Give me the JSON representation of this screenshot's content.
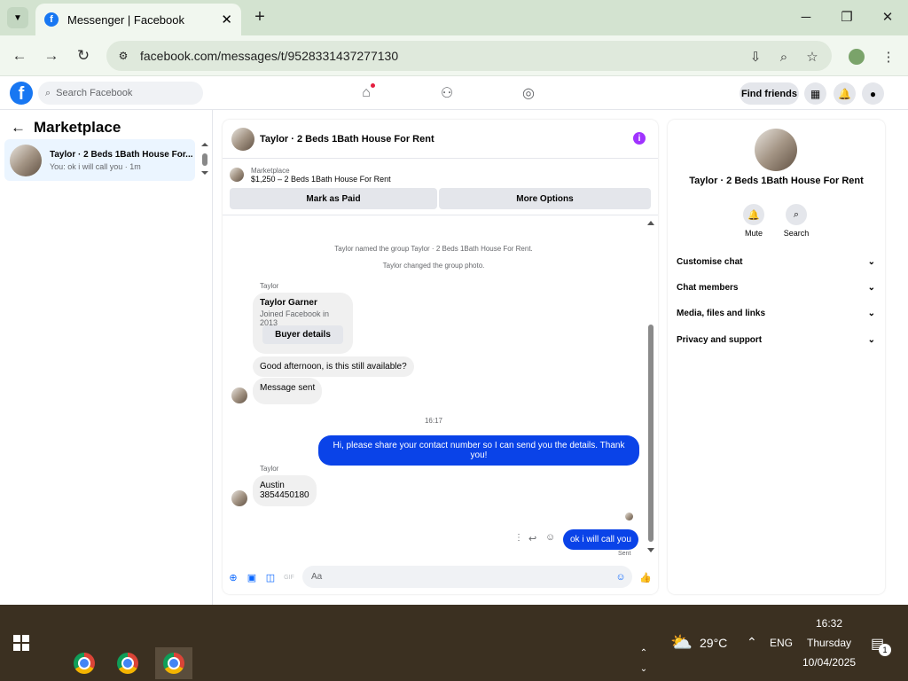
{
  "browser": {
    "tab_title": "Messenger | Facebook",
    "tab_favicon": "f",
    "new_tab": "+",
    "url": "facebook.com/messages/t/9528331437277130",
    "window_controls": [
      "─",
      "❐",
      "✕"
    ]
  },
  "fb_header": {
    "logo": "f",
    "search_placeholder": "Search Facebook",
    "find_friends": "Find friends"
  },
  "left": {
    "title": "Marketplace",
    "conversation": {
      "name": "Taylor · 2 Beds 1Bath House For...",
      "preview": "You: ok i will call you · 1m"
    }
  },
  "chat": {
    "title": "Taylor · 2 Beds 1Bath House For Rent",
    "marketplace_label": "Marketplace",
    "listing": "$1,250 – 2 Beds 1Bath House For Rent",
    "mark_paid": "Mark as Paid",
    "more_options": "More Options",
    "system_messages": [
      "Taylor named the group Taylor · 2 Beds 1Bath House For Rent.",
      "Taylor changed the group photo."
    ],
    "sender1": "Taylor",
    "profile_name": "Taylor Garner",
    "profile_sub": "Joined Facebook in 2013",
    "buyer_details": "Buyer details",
    "msg1": "Good afternoon, is this still available?",
    "msg2": "Message sent",
    "time": "16:17",
    "my_msg1": "Hi, please share your contact number so I can send you the details. Thank you!",
    "sender2": "Taylor",
    "msg3_line1": "Austin",
    "msg3_line2": "3854450180",
    "my_msg2": "ok i will call you",
    "status": "Sent",
    "composer_placeholder": "Aa"
  },
  "right": {
    "title": "Taylor · 2 Beds 1Bath House For Rent",
    "mute": "Mute",
    "search": "Search",
    "rows": [
      "Customise chat",
      "Chat members",
      "Media, files and links",
      "Privacy and support"
    ]
  },
  "taskbar": {
    "temperature": "29°C",
    "language": "ENG",
    "time": "16:32",
    "day": "Thursday",
    "date": "10/04/2025",
    "notifications": "1"
  },
  "colors": {
    "fb_blue": "#1877f2",
    "my_bubble": "#0a43e8",
    "info_purple": "#a033ff",
    "taskbar": "#3b3021"
  }
}
